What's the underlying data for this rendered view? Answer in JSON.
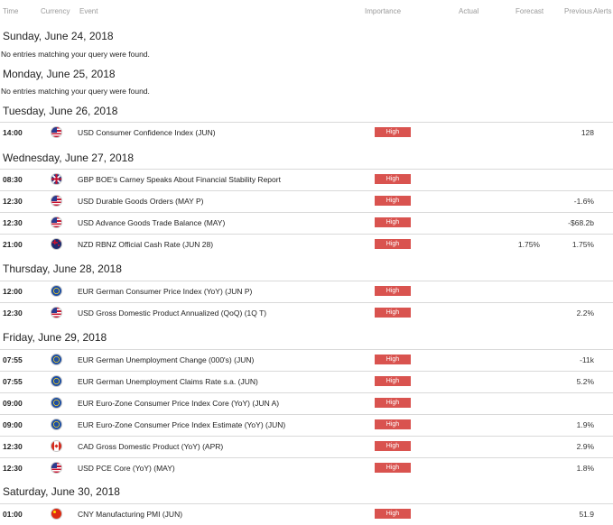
{
  "header": {
    "time": "Time",
    "currency": "Currency",
    "event": "Event",
    "importance": "Importance",
    "actual": "Actual",
    "forecast": "Forecast",
    "previous": "Previous",
    "alerts": "Alerts"
  },
  "empty_message": "No entries matching your query were found.",
  "days": [
    {
      "label": "Sunday, June 24, 2018",
      "empty": "No entries matching your query were found."
    },
    {
      "label": "Monday, June 25, 2018",
      "empty": "No entries matching your query were found."
    },
    {
      "label": "Tuesday, June 26, 2018"
    },
    {
      "label": "Wednesday, June 27, 2018"
    },
    {
      "label": "Thursday, June 28, 2018"
    },
    {
      "label": "Friday, June 29, 2018"
    },
    {
      "label": "Saturday, June 30, 2018"
    }
  ],
  "events": [
    {
      "time": "14:00",
      "flag": "us-flag-icon",
      "event": "USD Consumer Confidence Index (JUN)",
      "importance": "High",
      "actual": "",
      "forecast": "",
      "previous": "128"
    },
    {
      "time": "08:30",
      "flag": "gb-flag-icon",
      "event": "GBP BOE's Carney Speaks About Financial Stability Report",
      "importance": "High",
      "actual": "",
      "forecast": "",
      "previous": ""
    },
    {
      "time": "12:30",
      "flag": "us-flag-icon",
      "event": "USD Durable Goods Orders (MAY P)",
      "importance": "High",
      "actual": "",
      "forecast": "",
      "previous": "-1.6%"
    },
    {
      "time": "12:30",
      "flag": "us-flag-icon",
      "event": "USD Advance Goods Trade Balance (MAY)",
      "importance": "High",
      "actual": "",
      "forecast": "",
      "previous": "-$68.2b"
    },
    {
      "time": "21:00",
      "flag": "nz-flag-icon",
      "event": "NZD RBNZ Official Cash Rate (JUN 28)",
      "importance": "High",
      "actual": "",
      "forecast": "1.75%",
      "previous": "1.75%"
    },
    {
      "time": "12:00",
      "flag": "eu-flag-icon",
      "event": "EUR German Consumer Price Index (YoY) (JUN P)",
      "importance": "High",
      "actual": "",
      "forecast": "",
      "previous": ""
    },
    {
      "time": "12:30",
      "flag": "us-flag-icon",
      "event": "USD Gross Domestic Product Annualized (QoQ) (1Q T)",
      "importance": "High",
      "actual": "",
      "forecast": "",
      "previous": "2.2%"
    },
    {
      "time": "07:55",
      "flag": "eu-flag-icon",
      "event": "EUR German Unemployment Change (000's) (JUN)",
      "importance": "High",
      "actual": "",
      "forecast": "",
      "previous": "-11k"
    },
    {
      "time": "07:55",
      "flag": "eu-flag-icon",
      "event": "EUR German Unemployment Claims Rate s.a. (JUN)",
      "importance": "High",
      "actual": "",
      "forecast": "",
      "previous": "5.2%"
    },
    {
      "time": "09:00",
      "flag": "eu-flag-icon",
      "event": "EUR Euro-Zone Consumer Price Index Core (YoY) (JUN A)",
      "importance": "High",
      "actual": "",
      "forecast": "",
      "previous": ""
    },
    {
      "time": "09:00",
      "flag": "eu-flag-icon",
      "event": "EUR Euro-Zone Consumer Price Index Estimate (YoY) (JUN)",
      "importance": "High",
      "actual": "",
      "forecast": "",
      "previous": "1.9%"
    },
    {
      "time": "12:30",
      "flag": "ca-flag-icon",
      "event": "CAD Gross Domestic Product (YoY) (APR)",
      "importance": "High",
      "actual": "",
      "forecast": "",
      "previous": "2.9%"
    },
    {
      "time": "12:30",
      "flag": "us-flag-icon",
      "event": "USD PCE Core (YoY) (MAY)",
      "importance": "High",
      "actual": "",
      "forecast": "",
      "previous": "1.8%"
    },
    {
      "time": "01:00",
      "flag": "cn-flag-icon",
      "event": "CNY Manufacturing PMI (JUN)",
      "importance": "High",
      "actual": "",
      "forecast": "",
      "previous": "51.9"
    }
  ],
  "colors": {
    "importance_high": "#d9534f",
    "separator": "#d9d9d9"
  }
}
